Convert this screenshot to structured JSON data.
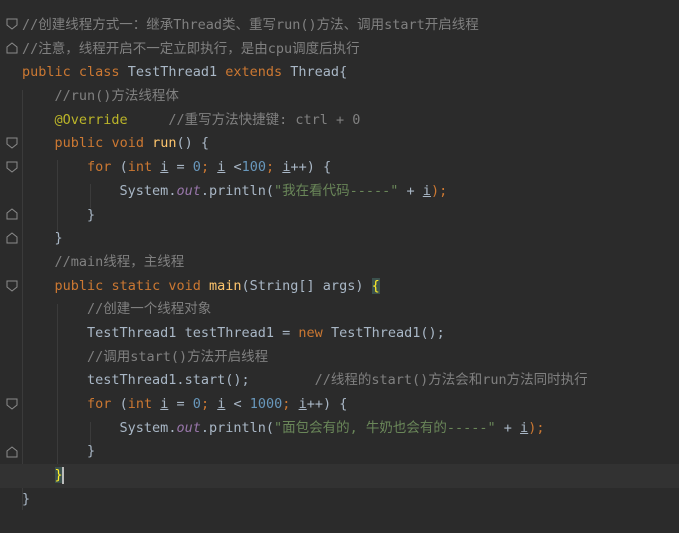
{
  "colors": {
    "background": "#2b2b2b",
    "keyword": "#cc7832",
    "comment": "#808080",
    "annotation": "#bbb529",
    "method_decl": "#ffc66d",
    "number": "#6897bb",
    "string": "#6a8759",
    "static_field": "#9876aa",
    "plain": "#a9b7c6"
  },
  "code": {
    "line1_comment": "//创建线程方式一：继承Thread类、重写run()方法、调用start开启线程",
    "line2_comment": "//注意，线程开启不一定立即执行，是由cpu调度后执行",
    "line3": {
      "kw_public": "public",
      "kw_class": "class",
      "class_name": "TestThread1",
      "kw_extends": "extends",
      "super_name": "Thread",
      "brace": "{"
    },
    "line4_comment": "//run()方法线程体",
    "line5": {
      "annotation": "@Override",
      "comment": "//重写方法快捷键: ctrl + 0"
    },
    "line6": {
      "kw_public": "public",
      "kw_void": "void",
      "method": "run",
      "rest": "() {"
    },
    "line7": {
      "kw_for": "for",
      "open": "(",
      "kw_int": "int",
      "var1": "i",
      "eq": "=",
      "num1": "0",
      "semi1": ";",
      "var2": "i",
      "lt": "<",
      "num2": "100",
      "semi2": ";",
      "var3": "i",
      "inc": "++) {"
    },
    "line8": {
      "system": "System.",
      "out": "out",
      "println": ".println(",
      "string": "\"我在看代码-----\"",
      "plus": " + ",
      "var": "i",
      "close": ");"
    },
    "line9": "}",
    "line10": "}",
    "line11_comment": "//main线程，主线程",
    "line12": {
      "kw_public": "public",
      "kw_static": "static",
      "kw_void": "void",
      "method": "main",
      "rest": "(String[] args) ",
      "brace": "{"
    },
    "line13_comment": "//创建一个线程对象",
    "line14": {
      "type": "TestThread1",
      "var": "testThread1",
      "eq": "=",
      "kw_new": "new",
      "ctor": "TestThread1",
      "rest": "();"
    },
    "line15_comment": "//调用start()方法开启线程",
    "line16": {
      "call": "testThread1.start();",
      "comment": "//线程的start()方法会和run方法同时执行"
    },
    "line17": {
      "kw_for": "for",
      "open": "(",
      "kw_int": "int",
      "var1": "i",
      "eq": "=",
      "num1": "0",
      "semi1": ";",
      "var2": "i",
      "lt": "<",
      "num2": "1000",
      "semi2": ";",
      "var3": "i",
      "inc": "++) {"
    },
    "line18": {
      "system": "System.",
      "out": "out",
      "println": ".println(",
      "string": "\"面包会有的, 牛奶也会有的-----\"",
      "plus": " + ",
      "var": "i",
      "close": ");"
    },
    "line19": "}",
    "line20": "}",
    "line21": "}"
  }
}
